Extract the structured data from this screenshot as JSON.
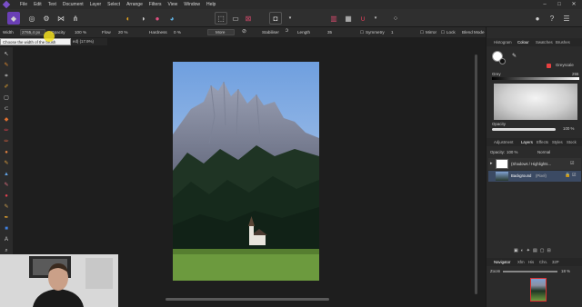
{
  "menu": [
    "File",
    "Edit",
    "Text",
    "Document",
    "Layer",
    "Select",
    "Arrange",
    "Filters",
    "View",
    "Window",
    "Help"
  ],
  "window_controls": {
    "minimize": "–",
    "maximize": "□",
    "close": "✕"
  },
  "context": {
    "width_label": "Width",
    "width_value": "2765,4 px",
    "opacity_label": "Opacity",
    "opacity_value": "100 %",
    "flow_label": "Flow",
    "flow_value": "20 %",
    "hardness_label": "Hardness",
    "hardness_value": "0 %",
    "more": "More",
    "stabiliser": "Stabiliser",
    "length_label": "Length",
    "length_value": "35",
    "symmetry_label": "Symmetry",
    "symmetry_value": "1",
    "mirror": "Mirror",
    "lock": "Lock",
    "blend_label": "Blend Mode",
    "blend_value": "Normal",
    "wet_edges": "Wet Edges"
  },
  "tooltip": "Choose the width of the brush",
  "doc_tab": "ed) (17.9%)",
  "colour_panel": {
    "tabs": [
      "Histogram",
      "Colour",
      "Swatches",
      "Brushes"
    ],
    "active_tab": "Colour",
    "mode": "Greyscale",
    "grey_label": "Grey",
    "grey_value": "255",
    "opacity_label": "Opacity",
    "opacity_value": "100 %"
  },
  "layers_panel": {
    "tabs": [
      "Adjustment",
      "Layers",
      "Effects",
      "Styles",
      "Stock"
    ],
    "active_tab": "Layers",
    "opacity_label": "Opacity:",
    "opacity_value": "100 %",
    "blend": "Normal",
    "layers": [
      {
        "name": "(Shadows / Highlights...",
        "state": "expanded"
      },
      {
        "name": "Background",
        "suffix": "(Pixel)"
      }
    ]
  },
  "navigator_panel": {
    "tabs": [
      "Navigator",
      "Xfm",
      "His",
      "Chn.",
      "32P"
    ],
    "active_tab": "Navigator",
    "zoom_label": "Zoom",
    "zoom_value": "18 %"
  },
  "colors": {
    "accent": "#e8387a",
    "tooltip_highlight": "#f4e11e",
    "panel_bg": "#2b2b2b",
    "canvas_bg": "#1e1e1e"
  }
}
